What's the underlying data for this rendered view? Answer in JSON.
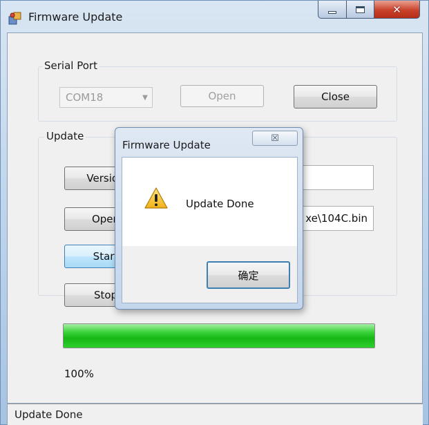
{
  "window": {
    "title": "Firmware Update"
  },
  "serial_port": {
    "group_label": "Serial Port",
    "port_value": "COM18",
    "open_label": "Open",
    "close_label": "Close"
  },
  "update": {
    "group_label": "Update",
    "version_label": "Version",
    "open_label": "Open",
    "file_path_visible": "xe\\104C.bin",
    "start_label": "Start",
    "stop_label": "Stop",
    "progress_fraction": 1.0,
    "progress_text": "100%"
  },
  "status_bar": {
    "text": "Update Done"
  },
  "dialog": {
    "title": "Firmware Update",
    "message": "Update Done",
    "ok_label": "确定",
    "close_glyph": "☒"
  },
  "colors": {
    "progress_green": "#16b816",
    "title_bar_blue": "#b9d1ea",
    "close_red": "#c8412a"
  },
  "icons": {
    "app": "app-installer-icon",
    "dialog": "warning-icon"
  }
}
